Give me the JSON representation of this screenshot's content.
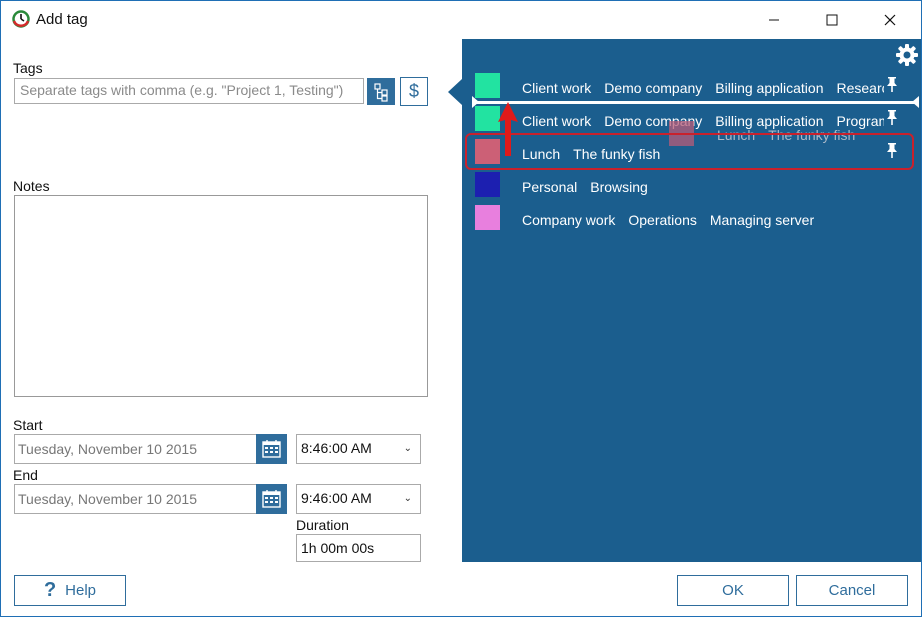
{
  "window": {
    "title": "Add tag"
  },
  "tags": {
    "label": "Tags",
    "placeholder": "Separate tags with comma (e.g. \"Project 1, Testing\")"
  },
  "notes": {
    "label": "Notes",
    "value": ""
  },
  "start": {
    "label": "Start",
    "date": "Tuesday, November 10 2015",
    "time": "8:46:00 AM"
  },
  "end": {
    "label": "End",
    "date": "Tuesday, November 10 2015",
    "time": "9:46:00 AM"
  },
  "duration": {
    "label": "Duration",
    "value": "1h 00m 00s"
  },
  "tag_list": [
    {
      "color": "#22e3a1",
      "tags": [
        "Client work",
        "Demo company",
        "Billing application",
        "Research"
      ]
    },
    {
      "color": "#22e3a1",
      "tags": [
        "Client work",
        "Demo company",
        "Billing application",
        "Program"
      ]
    },
    {
      "color": "#cc6076",
      "tags": [
        "Lunch",
        "The funky fish"
      ]
    },
    {
      "color": "#1c1fb0",
      "tags": [
        "Personal",
        "Browsing"
      ]
    },
    {
      "color": "#e87fde",
      "tags": [
        "Company work",
        "Operations",
        "Managing server"
      ]
    }
  ],
  "drag_ghost": {
    "tags": [
      "Lunch",
      "The funky fish"
    ]
  },
  "footer": {
    "help_label": "Help",
    "ok_label": "OK",
    "cancel_label": "Cancel"
  },
  "icons": {
    "window_minimize": "minimize-icon",
    "window_maximize": "maximize-icon",
    "window_close": "close-icon",
    "tag_tree": "tree-icon",
    "billable": "dollar-icon",
    "calendar": "calendar-icon",
    "settings": "gear-icon",
    "pin": "pin-icon",
    "help": "question-icon"
  },
  "colors": {
    "accent": "#2f6d9c",
    "panel": "#1b5e8e",
    "highlight": "#c9212c"
  }
}
